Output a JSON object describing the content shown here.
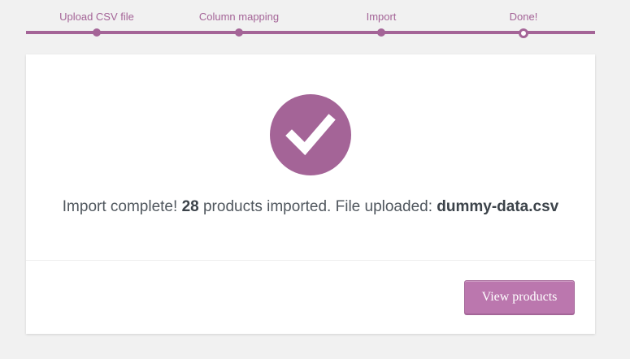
{
  "steps": [
    {
      "label": "Upload CSV file",
      "state": "done"
    },
    {
      "label": "Column mapping",
      "state": "done"
    },
    {
      "label": "Import",
      "state": "done"
    },
    {
      "label": "Done!",
      "state": "current"
    }
  ],
  "result": {
    "icon": "checkmark-icon",
    "prefix": "Import complete!",
    "count": "28",
    "middle": "products imported. File uploaded:",
    "filename": "dummy-data.csv"
  },
  "actions": {
    "view_products_label": "View products"
  },
  "colors": {
    "accent": "#a46497",
    "button": "#bb77ae",
    "background": "#f1f1f1"
  }
}
